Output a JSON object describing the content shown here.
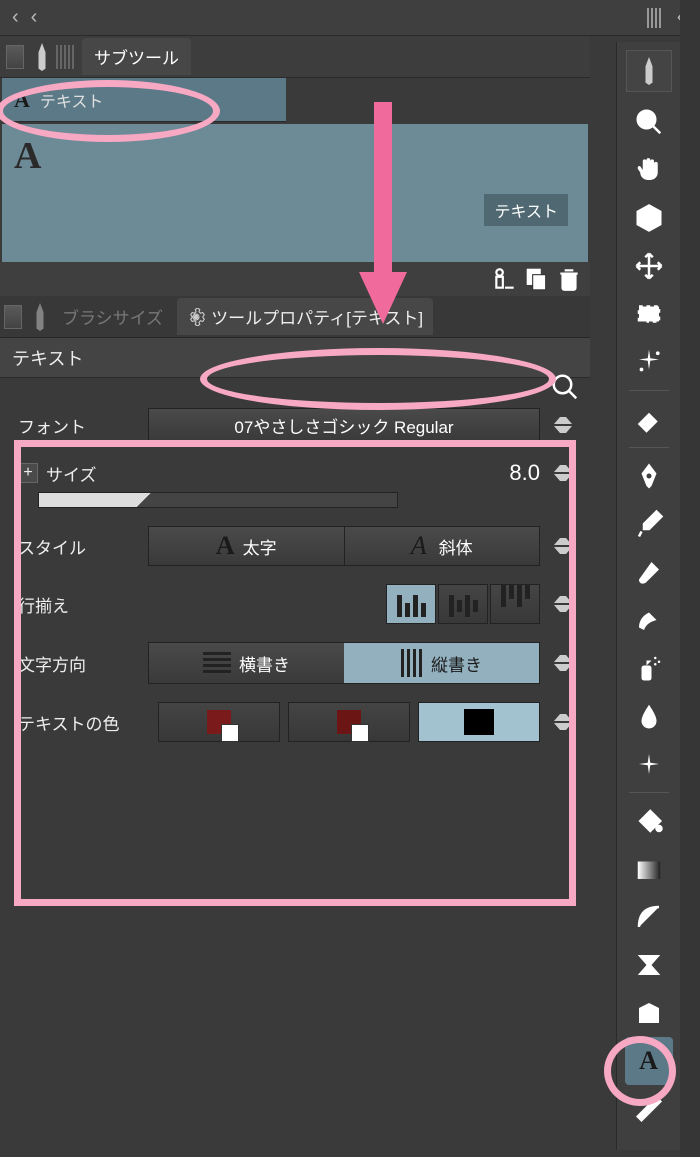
{
  "subtool": {
    "panel_title": "サブツール",
    "text_tab": "テキスト",
    "text_label": "テキスト"
  },
  "brush_tab": "ブラシサイズ",
  "property_tab": "ツールプロパティ[テキスト]",
  "panel_title": "テキスト",
  "font": {
    "label": "フォント",
    "value": "07やさしさゴシック Regular"
  },
  "size": {
    "label": "サイズ",
    "value": "8.0"
  },
  "style": {
    "label": "スタイル",
    "bold": "太字",
    "italic": "斜体"
  },
  "align": {
    "label": "行揃え"
  },
  "direction": {
    "label": "文字方向",
    "horizontal": "横書き",
    "vertical": "縦書き"
  },
  "textcolor": {
    "label": "テキストの色",
    "main": "#7a1a1a",
    "secondary": "#6b1515",
    "active": "#000000"
  }
}
